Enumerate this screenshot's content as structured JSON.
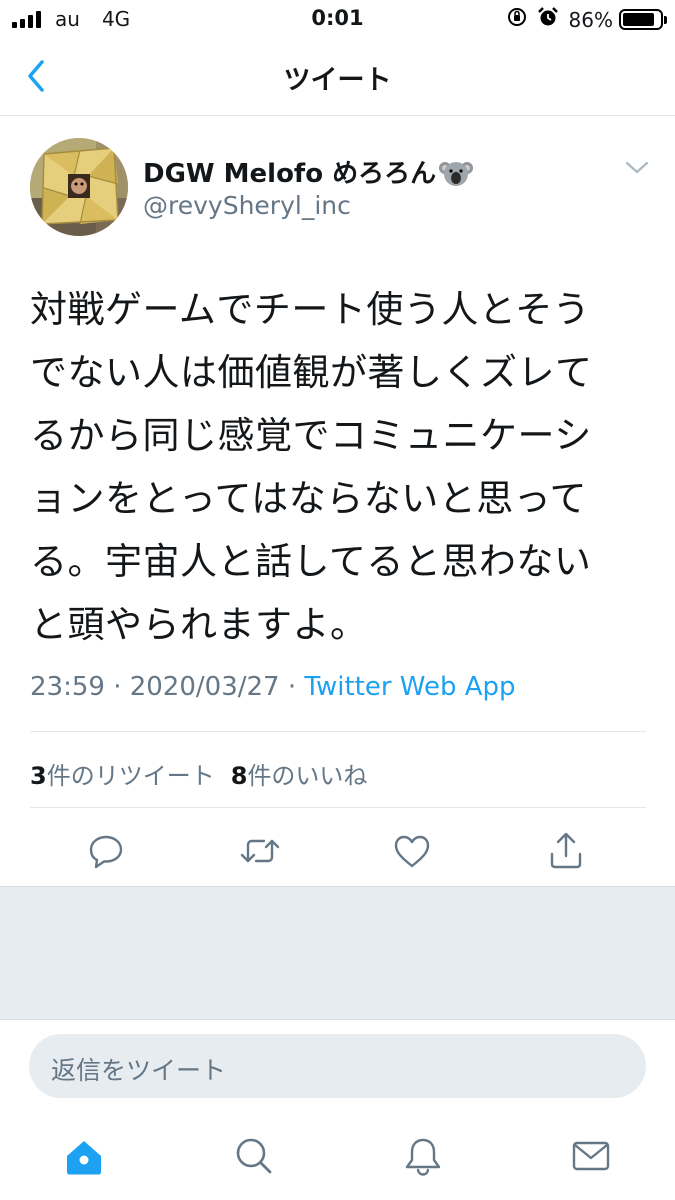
{
  "status_bar": {
    "carrier": "au",
    "network": "4G",
    "time": "0:01",
    "battery_percent": "86%",
    "battery_level": 0.86,
    "icons": [
      "signal-icon",
      "orientation-lock-icon",
      "alarm-icon",
      "battery-icon"
    ]
  },
  "nav": {
    "title": "ツイート",
    "back_icon": "chevron-left-icon"
  },
  "tweet": {
    "display_name": "DGW Melofo めろろん",
    "name_emoji": "koala-emoji",
    "handle": "@revySheryl_inc",
    "text": "対戦ゲームでチート使う人とそうでない人は価値観が著しくズレてるから同じ感覚でコミュニケーションをとってはならないと思ってる。宇宙人と話してると思わないと頭やられますよ。",
    "timestamp": "23:59 · 2020/03/27 · ",
    "source": "Twitter Web App",
    "retweet_count": "3",
    "retweet_label": "件のリツイート",
    "like_count": "8",
    "like_label": "件のいいね"
  },
  "actions": [
    "reply-icon",
    "retweet-icon",
    "like-icon",
    "share-icon"
  ],
  "reply": {
    "placeholder": "返信をツイート"
  },
  "tabbar": {
    "items": [
      "home-icon",
      "search-icon",
      "notifications-icon",
      "messages-icon"
    ],
    "active": "home-icon"
  },
  "colors": {
    "accent": "#1da1f2",
    "text": "#14171a",
    "secondary": "#657786",
    "divider": "#e1e8ed",
    "background_gray": "#e6ecf0"
  }
}
